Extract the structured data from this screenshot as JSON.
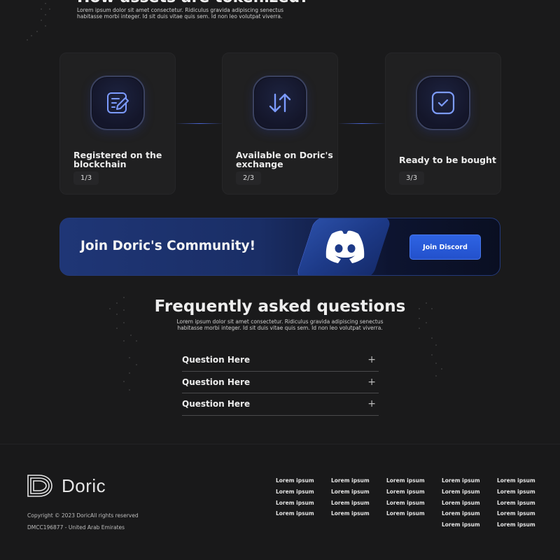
{
  "tokenize": {
    "title": "How assets are tokenized?",
    "description": "Lorem ipsum dolor sit amet consectetur. Ridiculus gravida adipiscing senectus habitasse morbi integer. Id sit duis vitae quis sem. Id non leo volutpat viverra."
  },
  "steps": [
    {
      "icon": "edit-document-icon",
      "label": "Registered on the blockchain",
      "badge": "1/3"
    },
    {
      "icon": "exchange-arrows-icon",
      "label": "Available on Doric's exchange",
      "badge": "2/3"
    },
    {
      "icon": "check-square-icon",
      "label": "Ready to be bought",
      "badge": "3/3"
    }
  ],
  "community": {
    "title": "Join Doric's Community!",
    "icon": "discord-icon",
    "button_label": "Join Discord"
  },
  "faq": {
    "title": "Frequently asked questions",
    "description": "Lorem ipsum dolor sit amet consectetur. Ridiculus gravida adipiscing senectus habitasse morbi integer. Id sit duis vitae quis sem. Id non leo volutpat viverra.",
    "items": [
      {
        "question": "Question Here"
      },
      {
        "question": "Question Here"
      },
      {
        "question": "Question Here"
      }
    ],
    "expand_icon": "plus-icon"
  },
  "footer": {
    "brand_name": "Doric",
    "logo_icon": "doric-logo-icon",
    "copyright": "Copyright © 2023 DoricAll rights reserved",
    "address": "DMCC196877 - United Arab Emirates",
    "columns": [
      [
        "Lorem ipsum",
        "Lorem ipsum",
        "Lorem ipsum",
        "Lorem ipsum"
      ],
      [
        "Lorem ipsum",
        "Lorem ipsum",
        "Lorem ipsum",
        "Lorem ipsum"
      ],
      [
        "Lorem ipsum",
        "Lorem ipsum",
        "Lorem ipsum",
        "Lorem ipsum"
      ],
      [
        "Lorem ipsum",
        "Lorem ipsum",
        "Lorem ipsum",
        "Lorem ipsum",
        "Lorem ipsum"
      ],
      [
        "Lorem ipsum",
        "Lorem ipsum",
        "Lorem ipsum",
        "Lorem ipsum",
        "Lorem ipsum"
      ]
    ]
  },
  "colors": {
    "background": "#1a1a1b",
    "card": "#202021",
    "accent": "#2e63e3",
    "icon_accent": "#7c9bff"
  }
}
